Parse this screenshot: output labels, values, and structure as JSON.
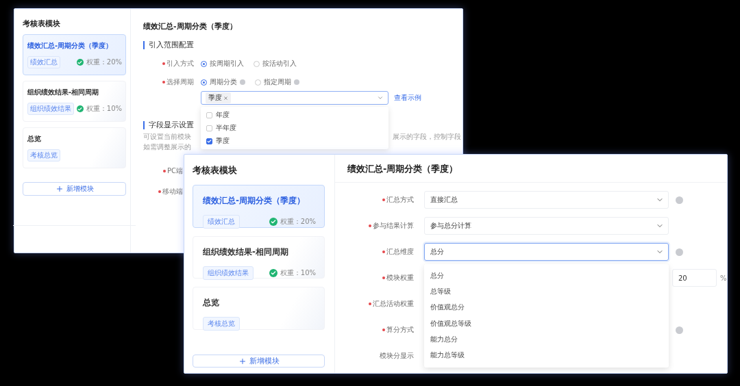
{
  "back_window": {
    "sidebar": {
      "title": "考核表模块",
      "add_button": "新增模块",
      "modules": [
        {
          "title": "绩效汇总-周期分类（季度）",
          "tag": "绩效汇总",
          "weight": "权重：20%",
          "selected": true
        },
        {
          "title": "组织绩效结果-相同周期",
          "tag": "组织绩效结果",
          "weight": "权重：10%",
          "selected": false
        },
        {
          "title": "总览",
          "tag": "考核总览",
          "selected": false
        }
      ]
    },
    "main": {
      "title": "绩效汇总-周期分类（季度）",
      "section_1": "引入范围配置",
      "radio_fields": [
        {
          "label": "引入方式",
          "required": true,
          "options": [
            {
              "label": "按周期引入",
              "selected": true,
              "help": false
            },
            {
              "label": "按活动引入",
              "selected": false,
              "help": false
            }
          ]
        },
        {
          "label": "选择周期",
          "required": true,
          "options": [
            {
              "label": "周期分类",
              "selected": true,
              "help": true
            },
            {
              "label": "指定周期",
              "selected": false,
              "help": true
            }
          ]
        }
      ],
      "period_select": {
        "tags": [
          "季度"
        ],
        "link": "查看示例",
        "options": [
          {
            "label": "年度",
            "checked": false
          },
          {
            "label": "半年度",
            "checked": false
          },
          {
            "label": "季度",
            "checked": true
          }
        ]
      },
      "section_2": "字段显示设置",
      "description_fragments": [
        {
          "left": "可设置当前模块",
          "right": "展示的字段，控制字段"
        },
        {
          "left": "如需调整展示的"
        }
      ],
      "field_labels": [
        {
          "label": "PC端",
          "required": true
        },
        {
          "label": "移动端",
          "required": true
        }
      ]
    }
  },
  "front_window": {
    "sidebar": {
      "title": "考核表模块",
      "add_button": "新增模块",
      "modules": [
        {
          "title": "绩效汇总-周期分类（季度）",
          "tag": "绩效汇总",
          "weight": "权重：20%",
          "selected": true
        },
        {
          "title": "组织绩效结果-相同周期",
          "tag": "组织绩效结果",
          "weight": "权重：10%",
          "selected": false
        },
        {
          "title": "总览",
          "tag": "考核总览",
          "selected": false
        }
      ]
    },
    "main": {
      "title": "绩效汇总-周期分类（季度）",
      "fields": [
        {
          "label": "汇总方式",
          "required": true,
          "kind": "select",
          "value": "直接汇总",
          "help": true,
          "focused": false
        },
        {
          "label": "参与结果计算",
          "required": true,
          "kind": "select",
          "value": "参与总分计算",
          "help": false,
          "focused": false
        },
        {
          "label": "汇总维度",
          "required": true,
          "kind": "select",
          "value": "总分",
          "help": true,
          "focused": true,
          "dropdown_options": [
            "总分",
            "总等级",
            "价值观总分",
            "价值观总等级",
            "能力总分",
            "能力总等级"
          ]
        },
        {
          "label": "模块权重",
          "required": true,
          "kind": "number",
          "value": "20",
          "unit": "%",
          "help": false
        },
        {
          "label": "汇总活动权重",
          "required": true,
          "kind": "blank",
          "help": false
        },
        {
          "label": "算分方式",
          "required": true,
          "kind": "blank",
          "help": true
        },
        {
          "label": "模块分显示",
          "required": false,
          "kind": "blank",
          "help": false
        }
      ]
    }
  }
}
